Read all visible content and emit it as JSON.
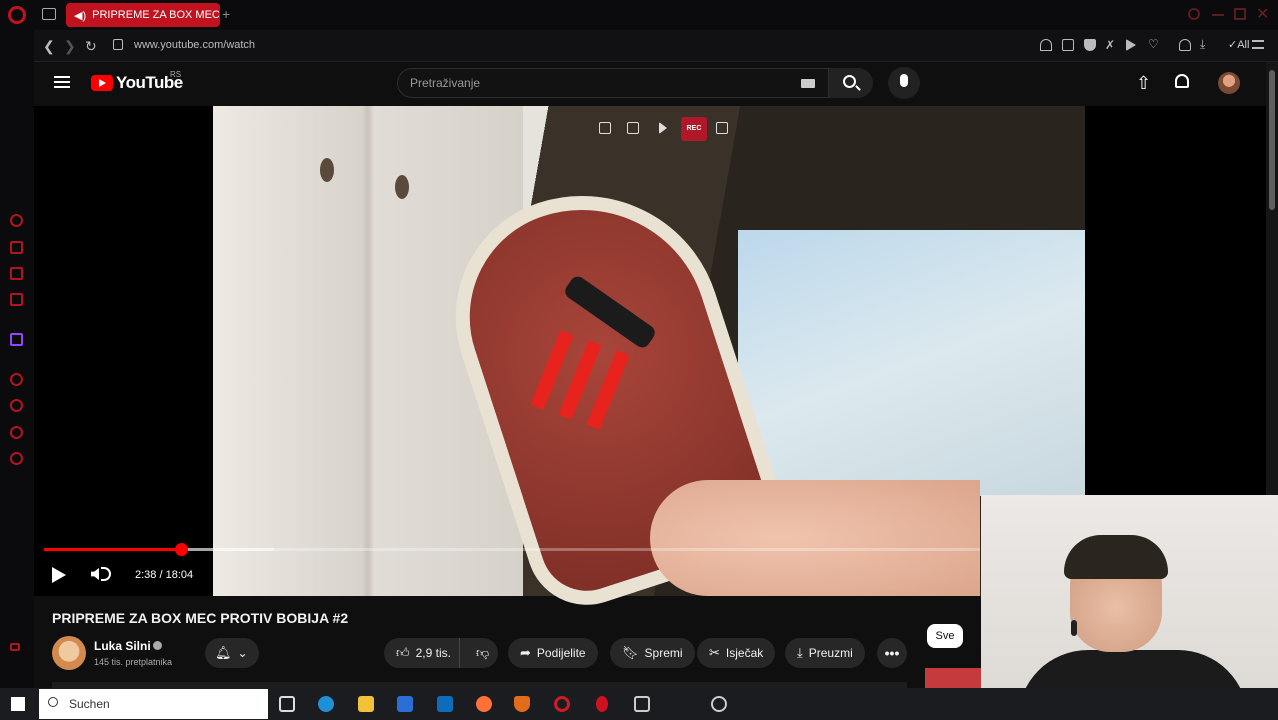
{
  "browser": {
    "tab_title": "PRIPREME ZA BOX MEC",
    "url": "www.youtube.com/watch",
    "ext_all_label": "All"
  },
  "youtube": {
    "logo_text": "YouTube",
    "logo_cc": "RS",
    "search_placeholder": "Pretraživanje"
  },
  "player": {
    "time_display": "2:38 / 18:04",
    "progress": 0.146,
    "toolbar_badge": "REC"
  },
  "video": {
    "title": "PRIPREME ZA BOX MEC PROTIV BOBIJA #2",
    "channel_name": "Luka Silni",
    "subscribers": "145 tis. pretplatnika",
    "likes": "2,9 tis.",
    "actions": {
      "share": "Podijelite",
      "save": "Spremi",
      "clip": "Isječak",
      "download": "Preuzmi",
      "more": "•••"
    },
    "filter_chip": "Sve"
  },
  "taskbar": {
    "search_placeholder": "Suchen"
  },
  "colors": {
    "accent": "#ff0000",
    "opera_red": "#c1121f",
    "background": "#0f0f0f"
  }
}
